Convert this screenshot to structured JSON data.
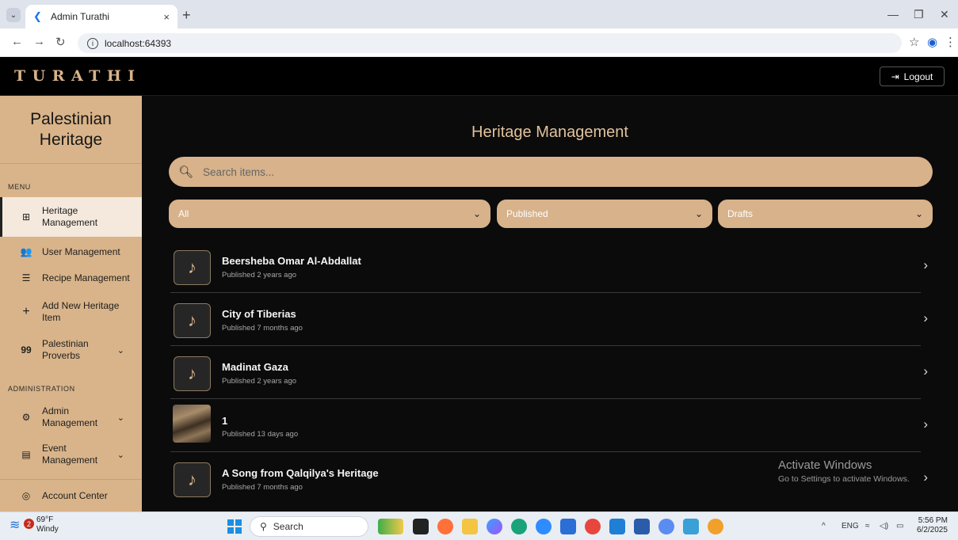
{
  "browser": {
    "tab_title": "Admin Turathi",
    "url": "localhost:64393",
    "new_tab": "+",
    "close_tab": "×"
  },
  "header": {
    "brand": "TURATHI",
    "logout_label": "Logout"
  },
  "sidebar": {
    "title": "Palestinian Heritage",
    "menu_label": "MENU",
    "admin_label": "ADMINISTRATION",
    "items": [
      {
        "label": "Heritage Management",
        "icon": "dashboard-icon",
        "active": true
      },
      {
        "label": "User Management",
        "icon": "users-icon"
      },
      {
        "label": "Recipe Management",
        "icon": "recipe-icon"
      },
      {
        "label": "Add New Heritage Item",
        "icon": "plus-icon"
      },
      {
        "label": "Palestinian Proverbs",
        "icon": "quote-icon",
        "expandable": true
      },
      {
        "label": "Admin Management",
        "icon": "admin-icon",
        "expandable": true
      },
      {
        "label": "Event Management",
        "icon": "calendar-icon",
        "expandable": true
      },
      {
        "label": "Account Center",
        "icon": "account-icon"
      }
    ]
  },
  "main": {
    "title": "Heritage Management",
    "search_placeholder": "Search items...",
    "filters": [
      {
        "label": "All"
      },
      {
        "label": "Published"
      },
      {
        "label": "Drafts"
      }
    ],
    "items": [
      {
        "title": "Beersheba Omar Al-Abdallat",
        "status": "Published 2 years ago",
        "thumb": "music-icon"
      },
      {
        "title": "City of Tiberias",
        "status": "Published 7 months ago",
        "thumb": "music-icon"
      },
      {
        "title": "Madinat Gaza",
        "status": "Published 2 years ago",
        "thumb": "music-icon"
      },
      {
        "title": "1",
        "status": "Published 13 days ago",
        "thumb": "photo"
      },
      {
        "title": "A Song from Qalqilya's Heritage",
        "status": "Published 7 months ago",
        "thumb": "music-icon"
      }
    ]
  },
  "watermark": {
    "line1": "Activate Windows",
    "line2": "Go to Settings to activate Windows."
  },
  "taskbar": {
    "weather_badge": "2",
    "temperature": "69°F",
    "condition": "Windy",
    "search_label": "Search",
    "language": "ENG",
    "time": "5:56 PM",
    "date": "6/2/2025"
  },
  "colors": {
    "accent": "#d7b28a",
    "background": "#0b0b0b",
    "title": "#e2c29d"
  }
}
